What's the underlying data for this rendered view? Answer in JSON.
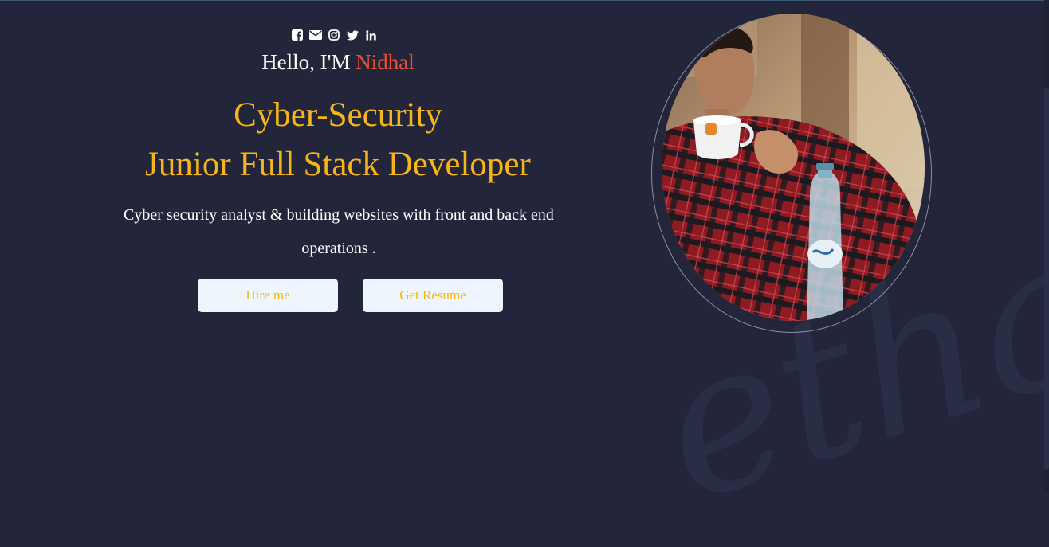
{
  "social": {
    "icons": [
      "facebook-icon",
      "envelope-icon",
      "instagram-icon",
      "twitter-icon",
      "linkedin-icon"
    ]
  },
  "hero": {
    "greeting": "Hello, I'M ",
    "name": "Nidhal",
    "role_1": "Cyber-Security",
    "role_2": "Junior Full Stack Developer",
    "description": "Cyber security analyst & building websites with front and back end operations .",
    "hire_label": "Hire me",
    "resume_label": "Get Resume"
  },
  "watermark": "etha",
  "colors": {
    "background": "#23263a",
    "accent": "#f7b616",
    "name": "#f04d36",
    "button_bg": "#eef6fd"
  }
}
